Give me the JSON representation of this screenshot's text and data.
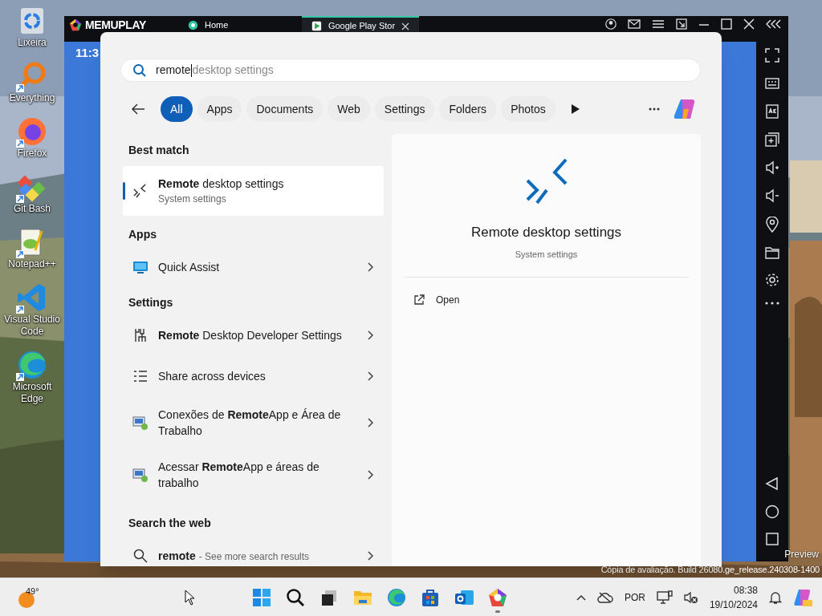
{
  "desktop_icons": [
    {
      "label": "Lixeira",
      "kind": "recycle"
    },
    {
      "label": "Everything",
      "kind": "everything"
    },
    {
      "label": "Firefox",
      "kind": "firefox"
    },
    {
      "label": "Git Bash",
      "kind": "git"
    },
    {
      "label": "Notepad++",
      "kind": "notepad"
    },
    {
      "label": "Visual Studio Code",
      "kind": "vscode"
    },
    {
      "label": "Microsoft Edge",
      "kind": "edge"
    }
  ],
  "emulator": {
    "logo": "MEMUPLAY",
    "clock": "11:3",
    "tabs": [
      {
        "label": "Home",
        "selected": false
      },
      {
        "label": "Google Play Stor",
        "selected": true
      }
    ]
  },
  "search": {
    "typed": "remote",
    "suggestion": "desktop settings",
    "filters": [
      {
        "label": "All",
        "selected": true
      },
      {
        "label": "Apps",
        "selected": false
      },
      {
        "label": "Documents",
        "selected": false
      },
      {
        "label": "Web",
        "selected": false
      },
      {
        "label": "Settings",
        "selected": false
      },
      {
        "label": "Folders",
        "selected": false
      },
      {
        "label": "Photos",
        "selected": false
      }
    ],
    "sections": [
      {
        "heading": "Best match",
        "items": [
          {
            "kind": "remote",
            "title": "**Remote** desktop settings",
            "subtitle": "System settings",
            "selected": true,
            "chevron": false
          }
        ]
      },
      {
        "heading": "Apps",
        "items": [
          {
            "kind": "assist",
            "title": "Quick Assist",
            "selected": false,
            "chevron": true
          }
        ]
      },
      {
        "heading": "Settings",
        "items": [
          {
            "kind": "developer",
            "title": "**Remote** Desktop Developer Settings",
            "selected": false,
            "chevron": true
          },
          {
            "kind": "share",
            "title": "Share across devices",
            "selected": false,
            "chevron": true
          },
          {
            "kind": "remoteapp",
            "title": "Conexões de **Remote**App e Área de Trabalho",
            "selected": false,
            "chevron": true
          },
          {
            "kind": "remoteapp",
            "title": "Acessar **Remote**App e áreas de trabalho",
            "selected": false,
            "chevron": true
          }
        ]
      },
      {
        "heading": "Search the web",
        "items": [
          {
            "kind": "web",
            "title": "**remote**",
            "note": "- See more search results",
            "selected": false,
            "chevron": true
          }
        ]
      }
    ],
    "preview": {
      "title": "Remote desktop settings",
      "subtitle": "System settings",
      "actions": [
        "Open"
      ]
    }
  },
  "watermark": {
    "edition": "Preview",
    "build": "Cópia de avaliação. Build 26080.ge_release.240308-1400"
  },
  "taskbar": {
    "weather": "49°",
    "apps": [
      {
        "kind": "start",
        "running": false
      },
      {
        "kind": "search",
        "running": false
      },
      {
        "kind": "taskview",
        "running": false
      },
      {
        "kind": "explorer",
        "running": false
      },
      {
        "kind": "edge",
        "running": false
      },
      {
        "kind": "store",
        "running": false
      },
      {
        "kind": "outlook",
        "running": false
      },
      {
        "kind": "memu",
        "running": true
      }
    ],
    "language": "POR",
    "time": "08:38",
    "date": "19/10/2024"
  }
}
